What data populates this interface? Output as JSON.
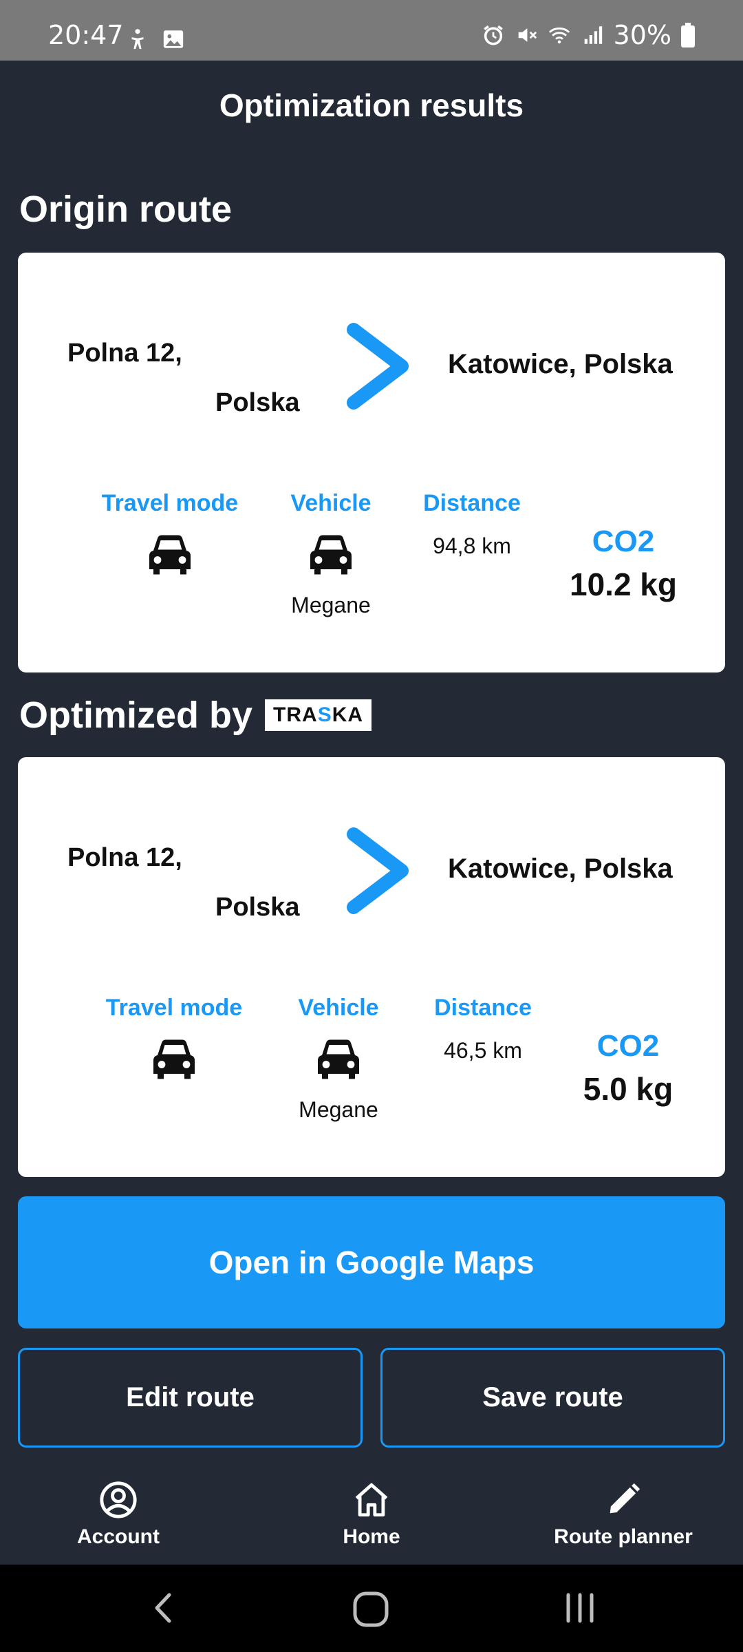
{
  "status_bar": {
    "time": "20:47",
    "battery": "30%"
  },
  "app_bar": {
    "title": "Optimization results"
  },
  "origin": {
    "section_title": "Origin route",
    "from_line1": "Polna 12,",
    "from_line2": "Polska",
    "to": "Katowice, Polska",
    "travel_mode_label": "Travel mode",
    "vehicle_label": "Vehicle",
    "vehicle_name": "Megane",
    "distance_label": "Distance",
    "distance": "94,8 km",
    "co2_label": "CO2",
    "co2_value": "10.2 kg"
  },
  "optimized": {
    "section_title": "Optimized by",
    "brand_logo": "TRASKA",
    "from_line1": "Polna 12,",
    "from_line2": "Polska",
    "to": "Katowice, Polska",
    "travel_mode_label": "Travel mode",
    "vehicle_label": "Vehicle",
    "vehicle_name": "Megane",
    "distance_label": "Distance",
    "distance": "46,5 km",
    "co2_label": "CO2",
    "co2_value": "5.0 kg"
  },
  "actions": {
    "google_maps": "Open in Google Maps",
    "edit_route": "Edit route",
    "save_route": "Save route"
  },
  "bottom_nav": [
    {
      "label": "Account",
      "icon": "account-circle-icon"
    },
    {
      "label": "Home",
      "icon": "home-icon"
    },
    {
      "label": "Route planner",
      "icon": "pencil-icon"
    }
  ],
  "colors": {
    "accent": "#1a98f5",
    "background": "#232a35",
    "card": "#ffffff"
  }
}
